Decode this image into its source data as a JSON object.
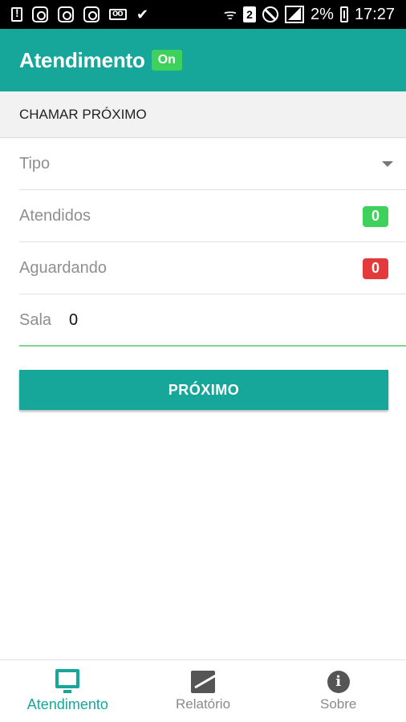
{
  "status_bar": {
    "left_icons": [
      "alert-icon",
      "instagram-icon",
      "instagram-icon",
      "instagram-icon",
      "voicemail-icon",
      "check-icon"
    ],
    "right_icons": [
      "wifi-icon",
      "sim2-icon",
      "no-disturb-icon",
      "signal-icon"
    ],
    "sim_label": "2",
    "battery": "2%",
    "time": "17:27"
  },
  "app_bar": {
    "title": "Atendimento",
    "status_badge": "On"
  },
  "section": {
    "header": "CHAMAR PRÓXIMO"
  },
  "form": {
    "tipo_label": "Tipo",
    "atendidos_label": "Atendidos",
    "atendidos_count": "0",
    "aguardando_label": "Aguardando",
    "aguardando_count": "0",
    "sala_label": "Sala",
    "sala_value": "0"
  },
  "actions": {
    "next_button": "PRÓXIMO"
  },
  "bottom_nav": {
    "items": [
      {
        "label": "Atendimento",
        "icon": "monitor-icon",
        "active": true
      },
      {
        "label": "Relatório",
        "icon": "chart-icon",
        "active": false
      },
      {
        "label": "Sobre",
        "icon": "info-icon",
        "active": false
      }
    ]
  },
  "colors": {
    "primary": "#17a79a",
    "success": "#3ed15b",
    "danger": "#e33b3b"
  }
}
